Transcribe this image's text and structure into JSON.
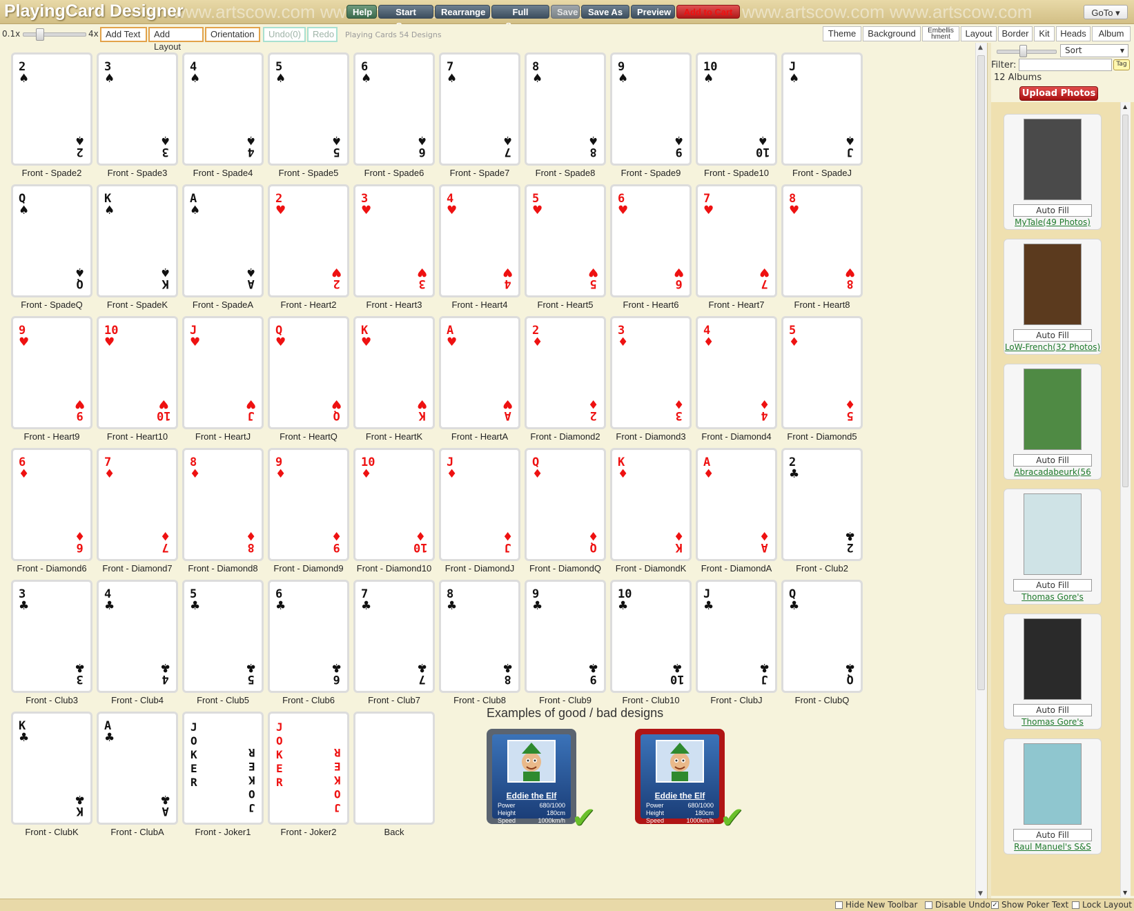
{
  "header": {
    "title": "PlayingCard Designer",
    "watermark": "www.artscow.com   www.artscow.com   www.artscow.com",
    "buttons": {
      "help": "Help",
      "start_over": "Start Over",
      "rearrange": "Rearrange",
      "full_screen": "Full Screen",
      "save": "Save",
      "save_as": "Save As",
      "preview": "Preview",
      "add_to_cart": "Add to Cart"
    },
    "goto": "GoTo ▾"
  },
  "toolbar": {
    "zoom_min": "0.1x",
    "zoom_max": "4x",
    "add_text": "Add Text",
    "add_layout": "Add Layout",
    "orientation": "Orientation",
    "undo": "Undo(0)",
    "redo": "Redo",
    "designs_count": "Playing Cards 54 Designs"
  },
  "right_tabs": [
    "Theme",
    "Background",
    "Embellishment",
    "Layout",
    "Border",
    "Kit",
    "Heads",
    "Album"
  ],
  "right_tab_small": "Embellis hment",
  "cards": [
    {
      "rank": "2",
      "suit": "♠",
      "color": "black",
      "label": "Front - Spade2"
    },
    {
      "rank": "3",
      "suit": "♠",
      "color": "black",
      "label": "Front - Spade3"
    },
    {
      "rank": "4",
      "suit": "♠",
      "color": "black",
      "label": "Front - Spade4"
    },
    {
      "rank": "5",
      "suit": "♠",
      "color": "black",
      "label": "Front - Spade5"
    },
    {
      "rank": "6",
      "suit": "♠",
      "color": "black",
      "label": "Front - Spade6"
    },
    {
      "rank": "7",
      "suit": "♠",
      "color": "black",
      "label": "Front - Spade7"
    },
    {
      "rank": "8",
      "suit": "♠",
      "color": "black",
      "label": "Front - Spade8"
    },
    {
      "rank": "9",
      "suit": "♠",
      "color": "black",
      "label": "Front - Spade9"
    },
    {
      "rank": "10",
      "suit": "♠",
      "color": "black",
      "label": "Front - Spade10"
    },
    {
      "rank": "J",
      "suit": "♠",
      "color": "black",
      "label": "Front - SpadeJ"
    },
    {
      "rank": "Q",
      "suit": "♠",
      "color": "black",
      "label": "Front - SpadeQ"
    },
    {
      "rank": "K",
      "suit": "♠",
      "color": "black",
      "label": "Front - SpadeK"
    },
    {
      "rank": "A",
      "suit": "♠",
      "color": "black",
      "label": "Front - SpadeA"
    },
    {
      "rank": "2",
      "suit": "♥",
      "color": "red",
      "label": "Front - Heart2"
    },
    {
      "rank": "3",
      "suit": "♥",
      "color": "red",
      "label": "Front - Heart3"
    },
    {
      "rank": "4",
      "suit": "♥",
      "color": "red",
      "label": "Front - Heart4"
    },
    {
      "rank": "5",
      "suit": "♥",
      "color": "red",
      "label": "Front - Heart5"
    },
    {
      "rank": "6",
      "suit": "♥",
      "color": "red",
      "label": "Front - Heart6"
    },
    {
      "rank": "7",
      "suit": "♥",
      "color": "red",
      "label": "Front - Heart7"
    },
    {
      "rank": "8",
      "suit": "♥",
      "color": "red",
      "label": "Front - Heart8"
    },
    {
      "rank": "9",
      "suit": "♥",
      "color": "red",
      "label": "Front - Heart9"
    },
    {
      "rank": "10",
      "suit": "♥",
      "color": "red",
      "label": "Front - Heart10"
    },
    {
      "rank": "J",
      "suit": "♥",
      "color": "red",
      "label": "Front - HeartJ"
    },
    {
      "rank": "Q",
      "suit": "♥",
      "color": "red",
      "label": "Front - HeartQ"
    },
    {
      "rank": "K",
      "suit": "♥",
      "color": "red",
      "label": "Front - HeartK"
    },
    {
      "rank": "A",
      "suit": "♥",
      "color": "red",
      "label": "Front - HeartA"
    },
    {
      "rank": "2",
      "suit": "♦",
      "color": "red",
      "label": "Front - Diamond2"
    },
    {
      "rank": "3",
      "suit": "♦",
      "color": "red",
      "label": "Front - Diamond3"
    },
    {
      "rank": "4",
      "suit": "♦",
      "color": "red",
      "label": "Front - Diamond4"
    },
    {
      "rank": "5",
      "suit": "♦",
      "color": "red",
      "label": "Front - Diamond5"
    },
    {
      "rank": "6",
      "suit": "♦",
      "color": "red",
      "label": "Front - Diamond6"
    },
    {
      "rank": "7",
      "suit": "♦",
      "color": "red",
      "label": "Front - Diamond7"
    },
    {
      "rank": "8",
      "suit": "♦",
      "color": "red",
      "label": "Front - Diamond8"
    },
    {
      "rank": "9",
      "suit": "♦",
      "color": "red",
      "label": "Front - Diamond9"
    },
    {
      "rank": "10",
      "suit": "♦",
      "color": "red",
      "label": "Front - Diamond10"
    },
    {
      "rank": "J",
      "suit": "♦",
      "color": "red",
      "label": "Front - DiamondJ"
    },
    {
      "rank": "Q",
      "suit": "♦",
      "color": "red",
      "label": "Front - DiamondQ"
    },
    {
      "rank": "K",
      "suit": "♦",
      "color": "red",
      "label": "Front - DiamondK"
    },
    {
      "rank": "A",
      "suit": "♦",
      "color": "red",
      "label": "Front - DiamondA"
    },
    {
      "rank": "2",
      "suit": "♣",
      "color": "black",
      "label": "Front - Club2"
    },
    {
      "rank": "3",
      "suit": "♣",
      "color": "black",
      "label": "Front - Club3"
    },
    {
      "rank": "4",
      "suit": "♣",
      "color": "black",
      "label": "Front - Club4"
    },
    {
      "rank": "5",
      "suit": "♣",
      "color": "black",
      "label": "Front - Club5"
    },
    {
      "rank": "6",
      "suit": "♣",
      "color": "black",
      "label": "Front - Club6"
    },
    {
      "rank": "7",
      "suit": "♣",
      "color": "black",
      "label": "Front - Club7"
    },
    {
      "rank": "8",
      "suit": "♣",
      "color": "black",
      "label": "Front - Club8"
    },
    {
      "rank": "9",
      "suit": "♣",
      "color": "black",
      "label": "Front - Club9"
    },
    {
      "rank": "10",
      "suit": "♣",
      "color": "black",
      "label": "Front - Club10"
    },
    {
      "rank": "J",
      "suit": "♣",
      "color": "black",
      "label": "Front - ClubJ"
    },
    {
      "rank": "Q",
      "suit": "♣",
      "color": "black",
      "label": "Front - ClubQ"
    },
    {
      "rank": "K",
      "suit": "♣",
      "color": "black",
      "label": "Front - ClubK"
    },
    {
      "rank": "A",
      "suit": "♣",
      "color": "black",
      "label": "Front - ClubA"
    },
    {
      "rank": "JOKER",
      "suit": "",
      "color": "black",
      "label": "Front - Joker1",
      "joker": true
    },
    {
      "rank": "JOKER",
      "suit": "",
      "color": "red",
      "label": "Front - Joker2",
      "joker": true
    },
    {
      "rank": "",
      "suit": "",
      "color": "black",
      "label": "Back",
      "blank": true
    }
  ],
  "examples": {
    "title": "Examples of good / bad designs",
    "items": [
      {
        "name": "Eddie the Elf",
        "power_label": "Power",
        "power": "680/1000",
        "height_label": "Height",
        "height": "180cm",
        "speed_label": "Speed",
        "speed": "1000km/h",
        "frame_color": "#5b6470"
      },
      {
        "name": "Eddie the Elf",
        "power_label": "Power",
        "power": "680/1000",
        "height_label": "Height",
        "height": "180cm",
        "speed_label": "Speed",
        "speed": "1000km/h",
        "frame_color": "#b01515"
      }
    ]
  },
  "albums_panel": {
    "sort": "Sort",
    "filter_label": "Filter:",
    "tag": "Tag",
    "albums_count": "12 Albums",
    "upload": "Upload Photos",
    "auto_fill": "Auto Fill",
    "albums": [
      {
        "name": "MyTale(49 Photos)",
        "thumb_color": "#4a4a4a"
      },
      {
        "name": "LoW-French(32 Photos)",
        "thumb_color": "#5b3a1e"
      },
      {
        "name": "Abracadabeurk(56",
        "thumb_color": "#4f8a44"
      },
      {
        "name": "Thomas Gore's",
        "thumb_color": "#cfe3e6"
      },
      {
        "name": "Thomas Gore's",
        "thumb_color": "#2a2a2a"
      },
      {
        "name": "Raul Manuel's S&S",
        "thumb_color": "#8fc6cf"
      }
    ]
  },
  "footer": {
    "hide_toolbar": "Hide New Toolbar",
    "disable_undo": "Disable Undo",
    "show_poker_text": "Show Poker Text",
    "lock_layout": "Lock Layout",
    "show_poker_text_checked": true
  }
}
